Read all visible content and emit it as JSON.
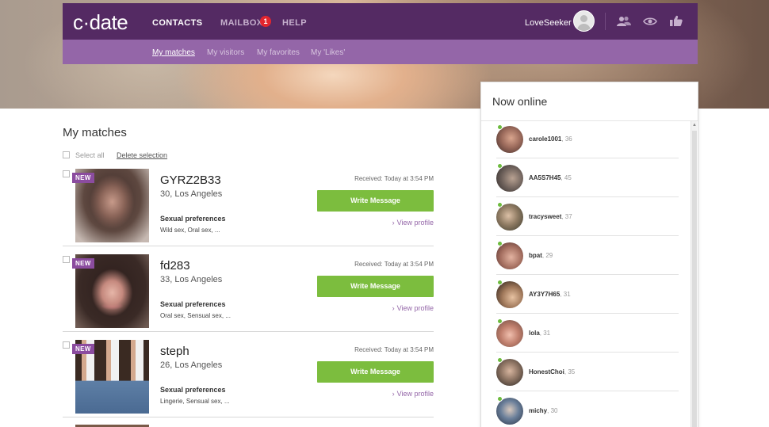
{
  "brand": {
    "logo_text": "c·date"
  },
  "nav": {
    "items": [
      {
        "label": "CONTACTS",
        "active": true
      },
      {
        "label": "MAILBOX",
        "active": false
      },
      {
        "label": "HELP",
        "active": false
      }
    ],
    "mailbox_badge": "1",
    "username": "LoveSeeker",
    "icons": [
      "contacts-people-icon",
      "visitors-eye-icon",
      "likes-thumbs-up-icon"
    ]
  },
  "subnav": {
    "items": [
      {
        "label": "My matches",
        "active": true
      },
      {
        "label": "My visitors",
        "active": false
      },
      {
        "label": "My favorites",
        "active": false
      },
      {
        "label": "My 'Likes'",
        "active": false
      }
    ]
  },
  "main": {
    "title": "My matches",
    "select_all": "Select all",
    "delete_selection": "Delete selection",
    "write_message_label": "Write Message",
    "view_profile_label": "View profile",
    "prefs_title": "Sexual preferences",
    "new_label": "NEW",
    "matches": [
      {
        "name": "GYRZ2B33",
        "age_location": "30, Los Angeles",
        "prefs": "Wild sex, Oral sex, ...",
        "received": "Received: Today at 3:54 PM"
      },
      {
        "name": "fd283",
        "age_location": "33, Los Angeles",
        "prefs": "Oral sex, Sensual sex, ...",
        "received": "Received: Today at 3:54 PM"
      },
      {
        "name": "steph",
        "age_location": "26, Los Angeles",
        "prefs": "Lingerie, Sensual sex, ...",
        "received": "Received: Today at 3:54 PM"
      }
    ]
  },
  "online": {
    "title": "Now online",
    "users": [
      {
        "name": "carole1001",
        "age": ", 36"
      },
      {
        "name": "AA5S7H45",
        "age": ", 45"
      },
      {
        "name": "tracysweet",
        "age": ", 37"
      },
      {
        "name": "bpat",
        "age": ", 29"
      },
      {
        "name": "AY3Y7H65",
        "age": ", 31"
      },
      {
        "name": "lola",
        "age": ", 31"
      },
      {
        "name": "HonestChoi",
        "age": ", 35"
      },
      {
        "name": "michy",
        "age": ", 30"
      }
    ]
  },
  "colors": {
    "topbar": "#542a63",
    "subbar": "#9466a8",
    "button_green": "#7cbd3e",
    "online_dot": "#6dbb3e",
    "badge_red": "#e2262e"
  }
}
